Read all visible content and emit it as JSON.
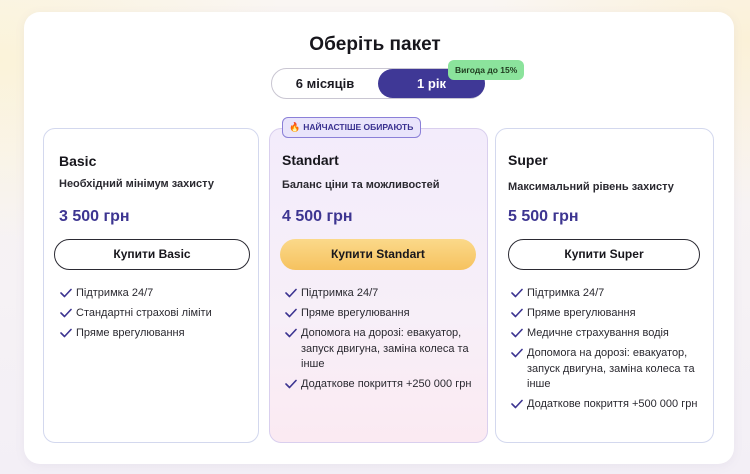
{
  "page": {
    "title": "Оберіть пакет"
  },
  "period_toggle": {
    "options": [
      {
        "label": "6 місяців",
        "selected": false
      },
      {
        "label": "1 рік",
        "selected": true
      }
    ],
    "discount_badge": "Вигода до 15%"
  },
  "colors": {
    "accent": "#3f3896",
    "primary_button": "#f6c25f",
    "discount_badge": "#8be39c",
    "check": "#3d3591"
  },
  "popular_badge": {
    "icon": "fire-icon",
    "label": "НАЙЧАСТІШЕ ОБИРАЮТЬ"
  },
  "plans": [
    {
      "name": "Basic",
      "description": "Необхідний мінімум захисту",
      "price": "3 500 грн",
      "button": "Купити Basic",
      "features": [
        "Підтримка 24/7",
        "Стандартні страхові ліміти",
        "Пряме врегулювання"
      ]
    },
    {
      "name": "Standart",
      "description": "Баланс ціни та можливостей",
      "price": "4 500 грн",
      "button": "Купити Standart",
      "features": [
        "Підтримка 24/7",
        "Пряме врегулювання",
        "Допомога на дорозі: евакуатор, запуск двигуна, заміна колеса та інше",
        "Додаткове покриття +250 000 грн"
      ]
    },
    {
      "name": "Super",
      "description": "Максимальний рівень захисту",
      "price": "5 500 грн",
      "button": "Купити Super",
      "features": [
        "Підтримка 24/7",
        "Пряме врегулювання",
        "Медичне страхування водія",
        "Допомога на дорозі: евакуатор, запуск двигуна, заміна колеса та інше",
        "Додаткове покриття +500 000 грн"
      ]
    }
  ]
}
